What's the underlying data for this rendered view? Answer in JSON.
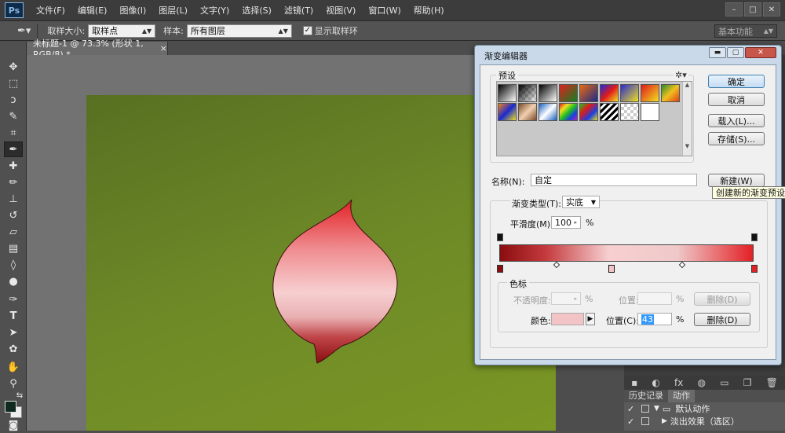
{
  "app": {
    "logo": "Ps",
    "menu": [
      "文件(F)",
      "编辑(E)",
      "图像(I)",
      "图层(L)",
      "文字(Y)",
      "选择(S)",
      "滤镜(T)",
      "视图(V)",
      "窗口(W)",
      "帮助(H)"
    ],
    "window_controls": [
      "–",
      "□",
      "✕"
    ]
  },
  "options_bar": {
    "sample_size_label": "取样大小:",
    "sample_size_value": "取样点",
    "sample_label": "样本:",
    "sample_value": "所有图层",
    "show_ring_label": "显示取样环",
    "show_ring_checked": "✓",
    "workspace": "基本功能"
  },
  "document": {
    "tab_title": "未标题-1 @ 73.3% (形状 1, RGB/8) *",
    "tab_close": "×"
  },
  "panels": {
    "history_tab": "历史记录",
    "actions_tab": "动作",
    "actions": [
      {
        "label": "默认动作"
      },
      {
        "label": "淡出效果（选区）"
      }
    ]
  },
  "dialog": {
    "title": "渐变编辑器",
    "presets_label": "预设",
    "buttons": {
      "ok": "确定",
      "cancel": "取消",
      "load": "载入(L)...",
      "save": "存储(S)...",
      "new": "新建(W)"
    },
    "tooltip": "创建新的渐变预设",
    "name_label": "名称(N):",
    "name_value": "自定",
    "gradient_type_label": "渐变类型(T):",
    "gradient_type_value": "实底",
    "smoothness_label": "平滑度(M):",
    "smoothness_value": "100",
    "smoothness_unit": "%",
    "stops_group_label": "色标",
    "opacity_label": "不透明度:",
    "opacity_unit": "%",
    "opacity_position_label": "位置:",
    "opacity_position_unit": "%",
    "opacity_delete": "删除(D)",
    "color_label": "颜色:",
    "color_value": "#f2c4c6",
    "color_position_label": "位置(C):",
    "color_position_value": "43",
    "color_position_unit": "%",
    "color_delete": "删除(D)",
    "gradient_colors": [
      "#8a0d10",
      "#c43a3d",
      "#f7cfd0",
      "#efc9c9",
      "#e22126"
    ]
  }
}
